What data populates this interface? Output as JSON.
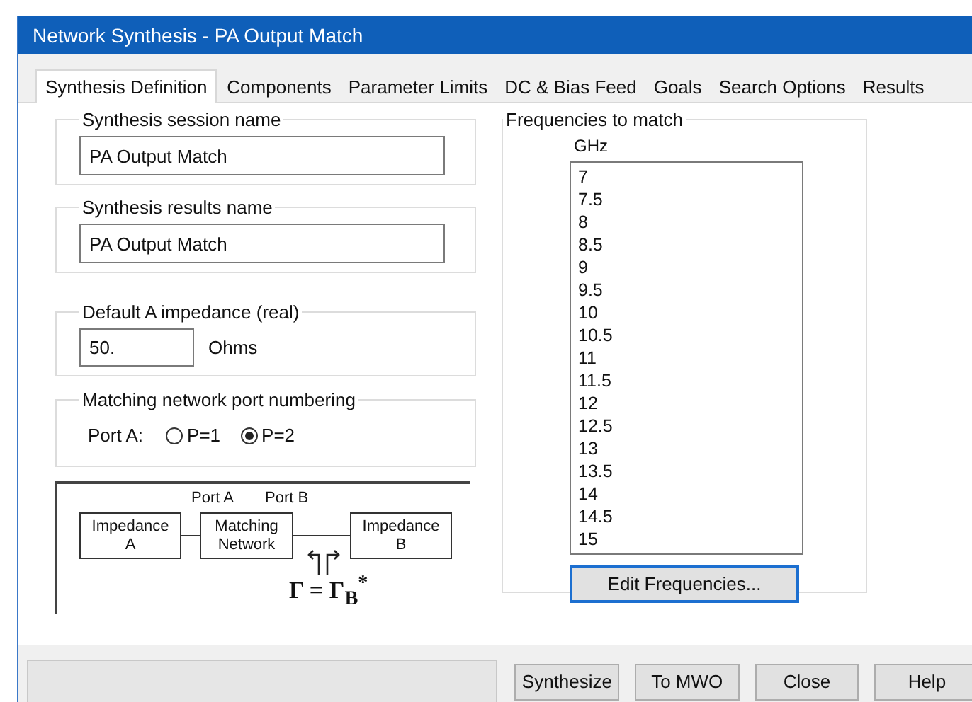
{
  "window": {
    "title": "Network Synthesis - PA Output Match"
  },
  "tabs": [
    {
      "label": "Synthesis Definition",
      "selected": true
    },
    {
      "label": "Components",
      "selected": false
    },
    {
      "label": "Parameter Limits",
      "selected": false
    },
    {
      "label": "DC & Bias Feed",
      "selected": false
    },
    {
      "label": "Goals",
      "selected": false
    },
    {
      "label": "Search Options",
      "selected": false
    },
    {
      "label": "Results",
      "selected": false
    }
  ],
  "session_name": {
    "label": "Synthesis session name",
    "value": "PA Output Match"
  },
  "results_name": {
    "label": "Synthesis results name",
    "value": "PA Output Match"
  },
  "impedance": {
    "label": "Default A impedance (real)",
    "value": "50.",
    "unit": "Ohms"
  },
  "port_numbering": {
    "label": "Matching network port numbering",
    "port_label": "Port A:",
    "options": [
      {
        "label": "P=1",
        "selected": false
      },
      {
        "label": "P=2",
        "selected": true
      }
    ]
  },
  "diagram": {
    "blocks": [
      {
        "lines": [
          "Impedance",
          "A"
        ]
      },
      {
        "lines": [
          "Matching",
          "Network"
        ]
      },
      {
        "lines": [
          "Impedance",
          "B"
        ]
      }
    ],
    "port_labels": [
      "Port A",
      "Port B"
    ],
    "formula": "Γ = Γ$_{B}$$^{*}$"
  },
  "frequencies": {
    "label": "Frequencies to match",
    "unit": "GHz",
    "items": [
      "7",
      "7.5",
      "8",
      "8.5",
      "9",
      "9.5",
      "10",
      "10.5",
      "11",
      "11.5",
      "12",
      "12.5",
      "13",
      "13.5",
      "14",
      "14.5",
      "15"
    ],
    "button": "Edit Frequencies..."
  },
  "buttons": [
    "Synthesize",
    "To MWO",
    "Close",
    "Help"
  ]
}
